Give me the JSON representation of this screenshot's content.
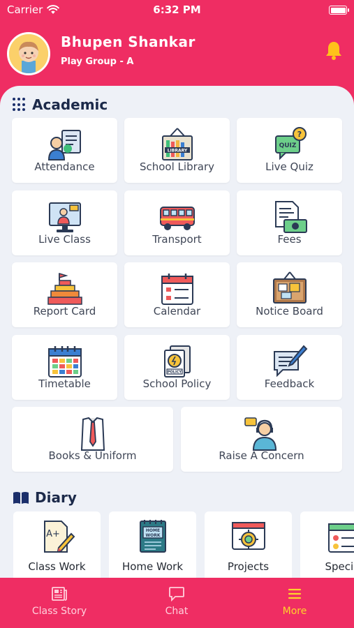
{
  "status_bar": {
    "carrier": "Carrier",
    "time": "6:32 PM"
  },
  "header": {
    "name": "Bhupen Shankar",
    "class": "Play Group - A"
  },
  "academic": {
    "title": "Academic",
    "items": [
      {
        "label": "Attendance",
        "icon": "attendance-icon"
      },
      {
        "label": "School Library",
        "icon": "library-icon"
      },
      {
        "label": "Live Quiz",
        "icon": "quiz-icon"
      },
      {
        "label": "Live Class",
        "icon": "live-class-icon"
      },
      {
        "label": "Transport",
        "icon": "bus-icon"
      },
      {
        "label": "Fees",
        "icon": "fees-icon"
      },
      {
        "label": "Report Card",
        "icon": "report-card-icon"
      },
      {
        "label": "Calendar",
        "icon": "calendar-icon"
      },
      {
        "label": "Notice Board",
        "icon": "notice-board-icon"
      },
      {
        "label": "Timetable",
        "icon": "timetable-icon"
      },
      {
        "label": "School Policy",
        "icon": "policy-icon"
      },
      {
        "label": "Feedback",
        "icon": "feedback-icon"
      },
      {
        "label": "Books & Uniform",
        "icon": "uniform-icon"
      },
      {
        "label": "Raise A Concern",
        "icon": "support-agent-icon"
      }
    ]
  },
  "diary": {
    "title": "Diary",
    "items": [
      {
        "label": "Class Work",
        "icon": "class-work-icon"
      },
      {
        "label": "Home Work",
        "icon": "home-work-icon"
      },
      {
        "label": "Projects",
        "icon": "projects-icon"
      },
      {
        "label": "Special",
        "icon": "special-icon"
      }
    ]
  },
  "tabs": [
    {
      "label": "Class Story",
      "icon": "newspaper-icon"
    },
    {
      "label": "Chat",
      "icon": "chat-icon"
    },
    {
      "label": "More",
      "icon": "menu-icon"
    }
  ],
  "colors": {
    "primary": "#ef2d63",
    "background": "#eef1f7",
    "active_tab": "#ffd42a",
    "section_title": "#1c2a4a"
  }
}
